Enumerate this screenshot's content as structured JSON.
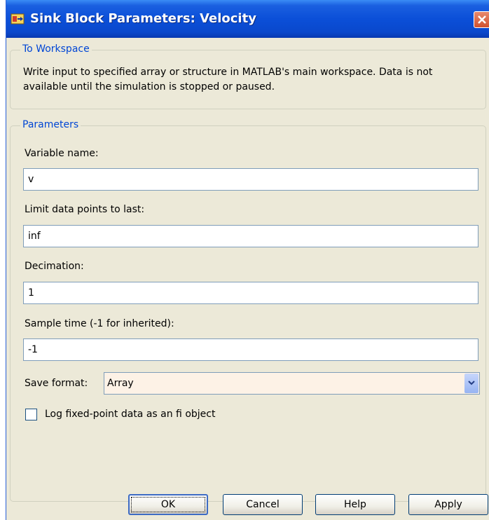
{
  "window": {
    "title": "Sink Block Parameters: Velocity",
    "icon": "simulink-block-icon",
    "close_icon": "close-icon"
  },
  "to_workspace": {
    "legend": "To Workspace",
    "description_line1": "Write input to specified array or structure in MATLAB's main workspace. Data is not",
    "description_line2": "available until the simulation is stopped or paused."
  },
  "parameters": {
    "legend": "Parameters",
    "variable_name": {
      "label": "Variable name:",
      "value": "v"
    },
    "limit_points": {
      "label": "Limit data points to last:",
      "value": "inf"
    },
    "decimation": {
      "label": "Decimation:",
      "value": "1"
    },
    "sample_time": {
      "label": "Sample time (-1 for inherited):",
      "value": "-1"
    },
    "save_format": {
      "label": "Save format:",
      "value": "Array"
    },
    "log_fixed_point": {
      "label": "Log fixed-point data as an fi object",
      "checked": false
    }
  },
  "buttons": {
    "ok": "OK",
    "cancel": "Cancel",
    "help": "Help",
    "apply": "Apply"
  }
}
